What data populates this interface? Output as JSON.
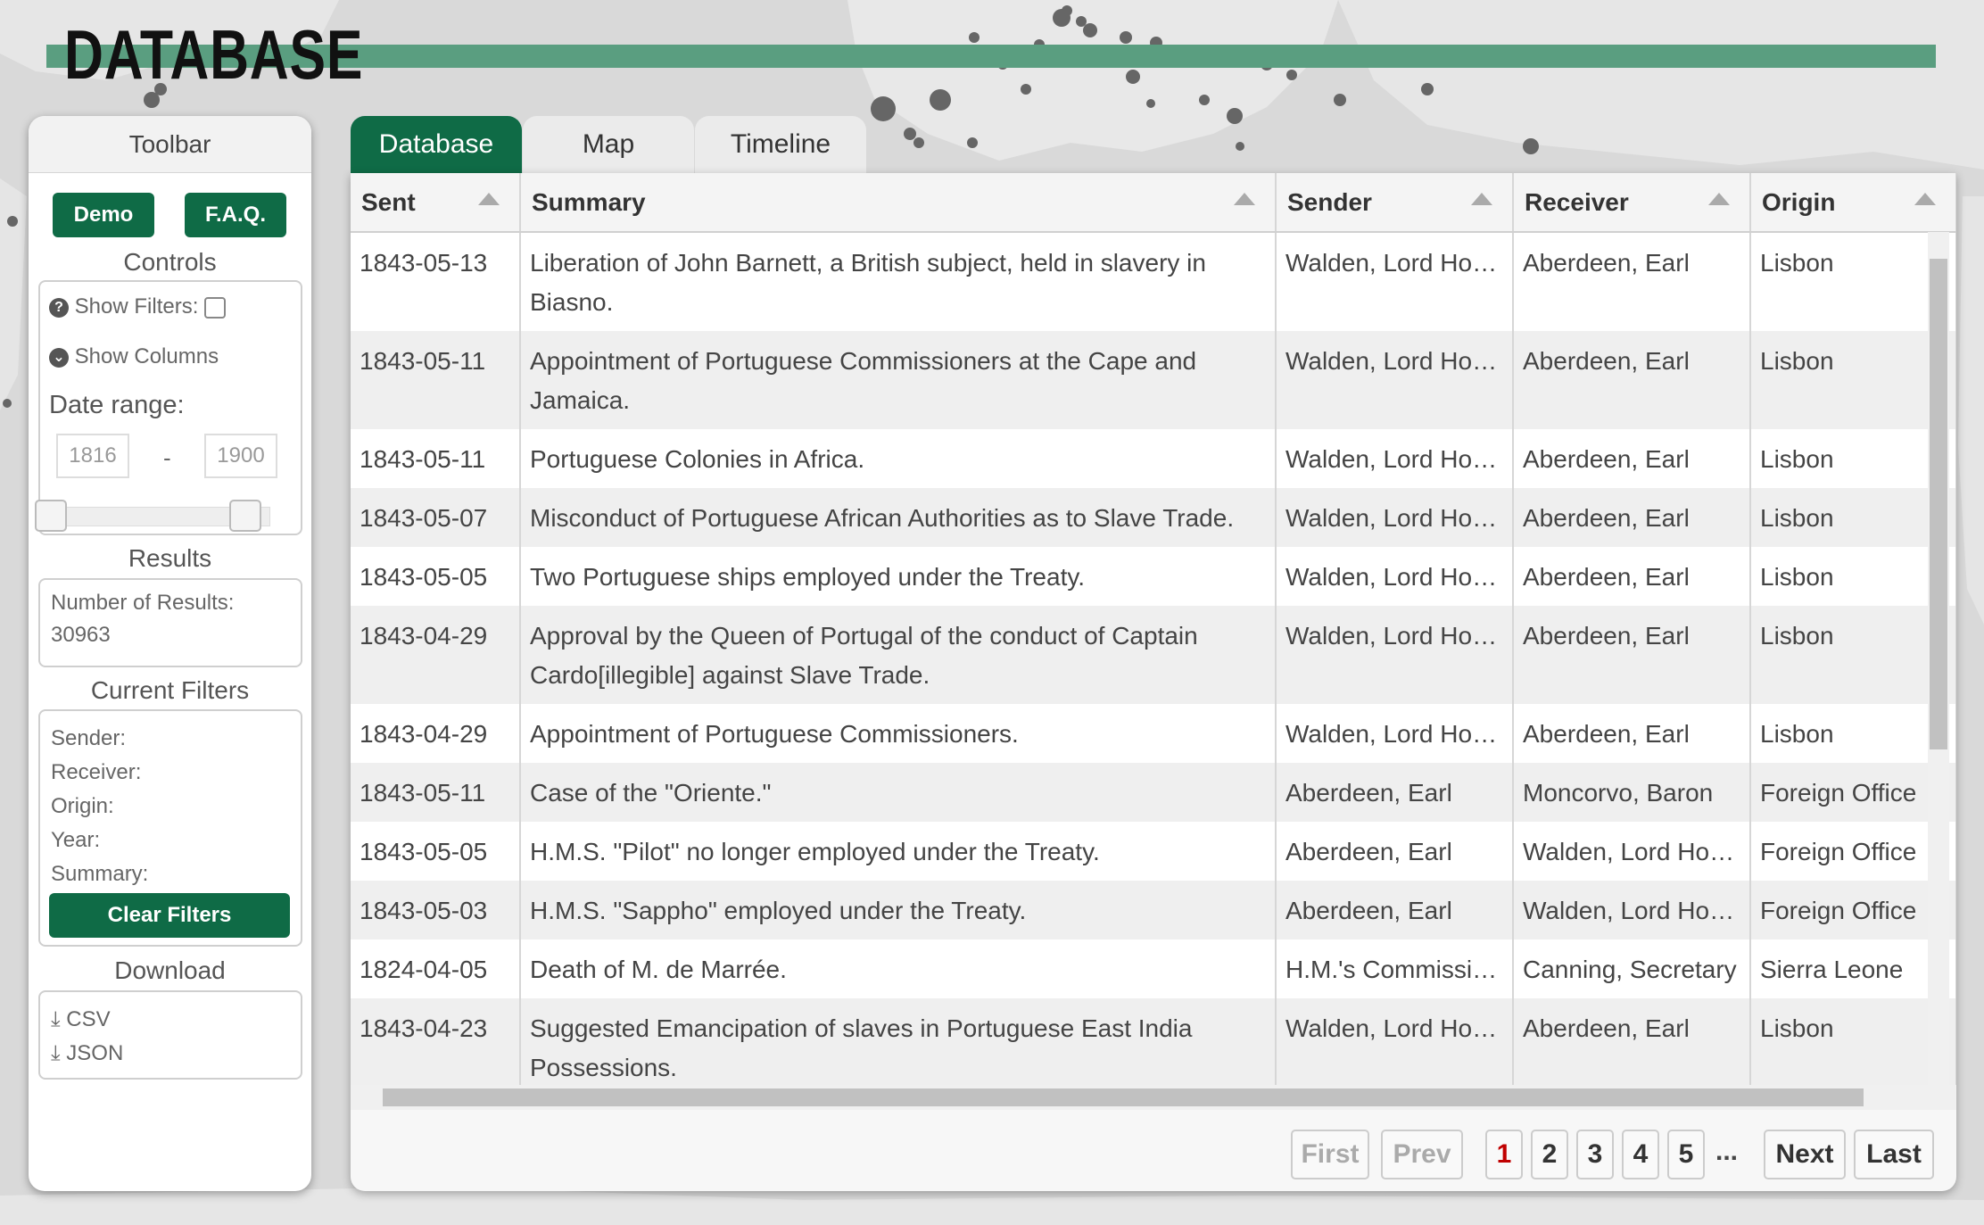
{
  "header": {
    "title": "DATABASE"
  },
  "sidebar": {
    "title": "Toolbar",
    "demo_label": "Demo",
    "faq_label": "F.A.Q.",
    "controls_title": "Controls",
    "show_filters_label": "Show Filters:",
    "show_columns_label": "Show Columns",
    "date_range_label": "Date range:",
    "date_from": "1816",
    "date_sep": "-",
    "date_to": "1900",
    "results_title": "Results",
    "results_label": "Number of Results:",
    "results_count": "30963",
    "filters_title": "Current Filters",
    "filter_sender": "Sender:",
    "filter_receiver": "Receiver:",
    "filter_origin": "Origin:",
    "filter_year": "Year:",
    "filter_summary": "Summary:",
    "clear_filters_label": "Clear Filters",
    "download_title": "Download",
    "download_csv": "CSV",
    "download_json": "JSON"
  },
  "tabs": [
    {
      "label": "Database"
    },
    {
      "label": "Map"
    },
    {
      "label": "Timeline"
    }
  ],
  "table": {
    "columns": [
      "Sent",
      "Summary",
      "Sender",
      "Receiver",
      "Origin"
    ],
    "rows": [
      {
        "sent": "1843-05-13",
        "summary": "Liberation of John Barnett, a British subject, held in slavery in Biasno.",
        "sender": "Walden, Lord Howard de",
        "receiver": "Aberdeen, Earl",
        "origin": "Lisbon"
      },
      {
        "sent": "1843-05-11",
        "summary": "Appointment of Portuguese Commissioners at the Cape and Jamaica.",
        "sender": "Walden, Lord Howard de",
        "receiver": "Aberdeen, Earl",
        "origin": "Lisbon"
      },
      {
        "sent": "1843-05-11",
        "summary": "Portuguese Colonies in Africa.",
        "sender": "Walden, Lord Howard de",
        "receiver": "Aberdeen, Earl",
        "origin": "Lisbon"
      },
      {
        "sent": "1843-05-07",
        "summary": "Misconduct of Portuguese African Authorities as to Slave Trade.",
        "sender": "Walden, Lord Howard de",
        "receiver": "Aberdeen, Earl",
        "origin": "Lisbon"
      },
      {
        "sent": "1843-05-05",
        "summary": "Two Portuguese ships employed under the Treaty.",
        "sender": "Walden, Lord Howard de",
        "receiver": "Aberdeen, Earl",
        "origin": "Lisbon"
      },
      {
        "sent": "1843-04-29",
        "summary": "Approval by the Queen of Portugal of the conduct of Captain Cardo[illegible] against Slave Trade.",
        "sender": "Walden, Lord Howard de",
        "receiver": "Aberdeen, Earl",
        "origin": "Lisbon"
      },
      {
        "sent": "1843-04-29",
        "summary": "Appointment of Portuguese Commissioners.",
        "sender": "Walden, Lord Howard de",
        "receiver": "Aberdeen, Earl",
        "origin": "Lisbon"
      },
      {
        "sent": "1843-05-11",
        "summary": "Case of the \"Oriente.\"",
        "sender": "Aberdeen, Earl",
        "receiver": "Moncorvo, Baron",
        "origin": "Foreign Office"
      },
      {
        "sent": "1843-05-05",
        "summary": "H.M.S. \"Pilot\" no longer employed under the Treaty.",
        "sender": "Aberdeen, Earl",
        "receiver": "Walden, Lord Howard de",
        "origin": "Foreign Office"
      },
      {
        "sent": "1843-05-03",
        "summary": "H.M.S. \"Sappho\" employed under the Treaty.",
        "sender": "Aberdeen, Earl",
        "receiver": "Walden, Lord Howard de",
        "origin": "Foreign Office"
      },
      {
        "sent": "1824-04-05",
        "summary": "Death of M. de Marrée.",
        "sender": "H.M.'s Commissioners",
        "receiver": "Canning, Secretary",
        "origin": "Sierra Leone"
      },
      {
        "sent": "1843-04-23",
        "summary": "Suggested Emancipation of slaves in Portuguese East India Possessions.",
        "sender": "Walden, Lord Howard de",
        "receiver": "Aberdeen, Earl",
        "origin": "Lisbon"
      }
    ]
  },
  "pagination": {
    "first": "First",
    "prev": "Prev",
    "pages": [
      "1",
      "2",
      "3",
      "4",
      "5"
    ],
    "ellipsis": "...",
    "next": "Next",
    "last": "Last",
    "current": "1"
  },
  "colors": {
    "accent": "#0f6b46",
    "brand_bar": "#5a9e80",
    "current_page": "#c00000"
  }
}
